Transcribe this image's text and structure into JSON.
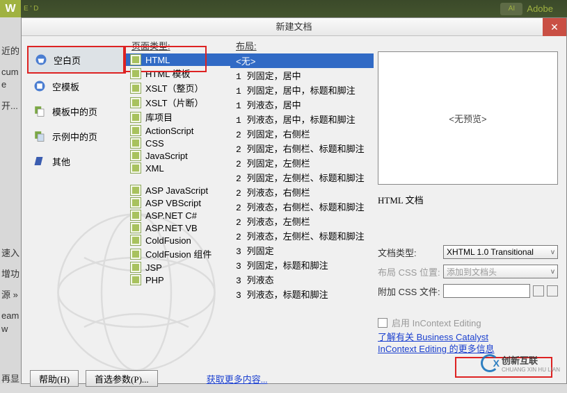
{
  "topbar": {
    "logo": "W",
    "sub": "E ' D",
    "adobe_label": "Adobe",
    "adobe_icon": "AI"
  },
  "dialog": {
    "title": "新建文档",
    "close": "✕"
  },
  "left_hints": {
    "h1": "近的",
    "h2": "cume",
    "h3": "开...",
    "h4": "速入",
    "h5": "增功",
    "h6": "源 »",
    "h7": "再显",
    "h8": "eamw"
  },
  "categories": {
    "blank_page": "空白页",
    "blank_tpl": "空模板",
    "from_tpl": "模板中的页",
    "from_sample": "示例中的页",
    "other": "其他"
  },
  "pagetype": {
    "header": "页面类型:",
    "html": "HTML",
    "html_tpl": "HTML 模板",
    "xslt_full": "XSLT（整页）",
    "xslt_frag": "XSLT（片断）",
    "lib": "库项目",
    "as": "ActionScript",
    "css": "CSS",
    "js": "JavaScript",
    "xml": "XML",
    "asp_js": "ASP JavaScript",
    "asp_vb": "ASP VBScript",
    "asp_cs": "ASP.NET C#",
    "asp_vbn": "ASP.NET VB",
    "cf": "ColdFusion",
    "cf_comp": "ColdFusion 组件",
    "jsp": "JSP",
    "php": "PHP"
  },
  "layouts": {
    "header": "布局:",
    "none": "<无>",
    "l1": "1 列固定，居中",
    "l2": "1 列固定，居中，标题和脚注",
    "l3": "1 列液态，居中",
    "l4": "1 列液态，居中，标题和脚注",
    "l5": "2 列固定，右侧栏",
    "l6": "2 列固定，右侧栏、标题和脚注",
    "l7": "2 列固定，左侧栏",
    "l8": "2 列固定，左侧栏、标题和脚注",
    "l9": "2 列液态，右侧栏",
    "l10": "2 列液态，右侧栏、标题和脚注",
    "l11": "2 列液态，左侧栏",
    "l12": "2 列液态，左侧栏、标题和脚注",
    "l13": "3 列固定",
    "l14": "3 列固定，标题和脚注",
    "l15": "3 列液态",
    "l16": "3 列液态，标题和脚注"
  },
  "right": {
    "no_preview": "<无预览>",
    "doc_label": "HTML 文档",
    "doctype_label": "文档类型:",
    "doctype_value": "XHTML 1.0 Transitional",
    "css_loc_label": "布局 CSS 位置:",
    "css_loc_value": "添加到文档头",
    "css_file_label": "附加 CSS 文件:",
    "chk_label": "启用 InContext Editing",
    "link1": "了解有关 Business Catalyst",
    "link2": "InContext Editing 的更多信息"
  },
  "footer": {
    "help": "帮助(H)",
    "prefs": "首选参数(P)...",
    "more": "获取更多内容..."
  },
  "watermark": {
    "t1": "创新互联",
    "t2": "CHUANG XIN HU LIAN"
  }
}
